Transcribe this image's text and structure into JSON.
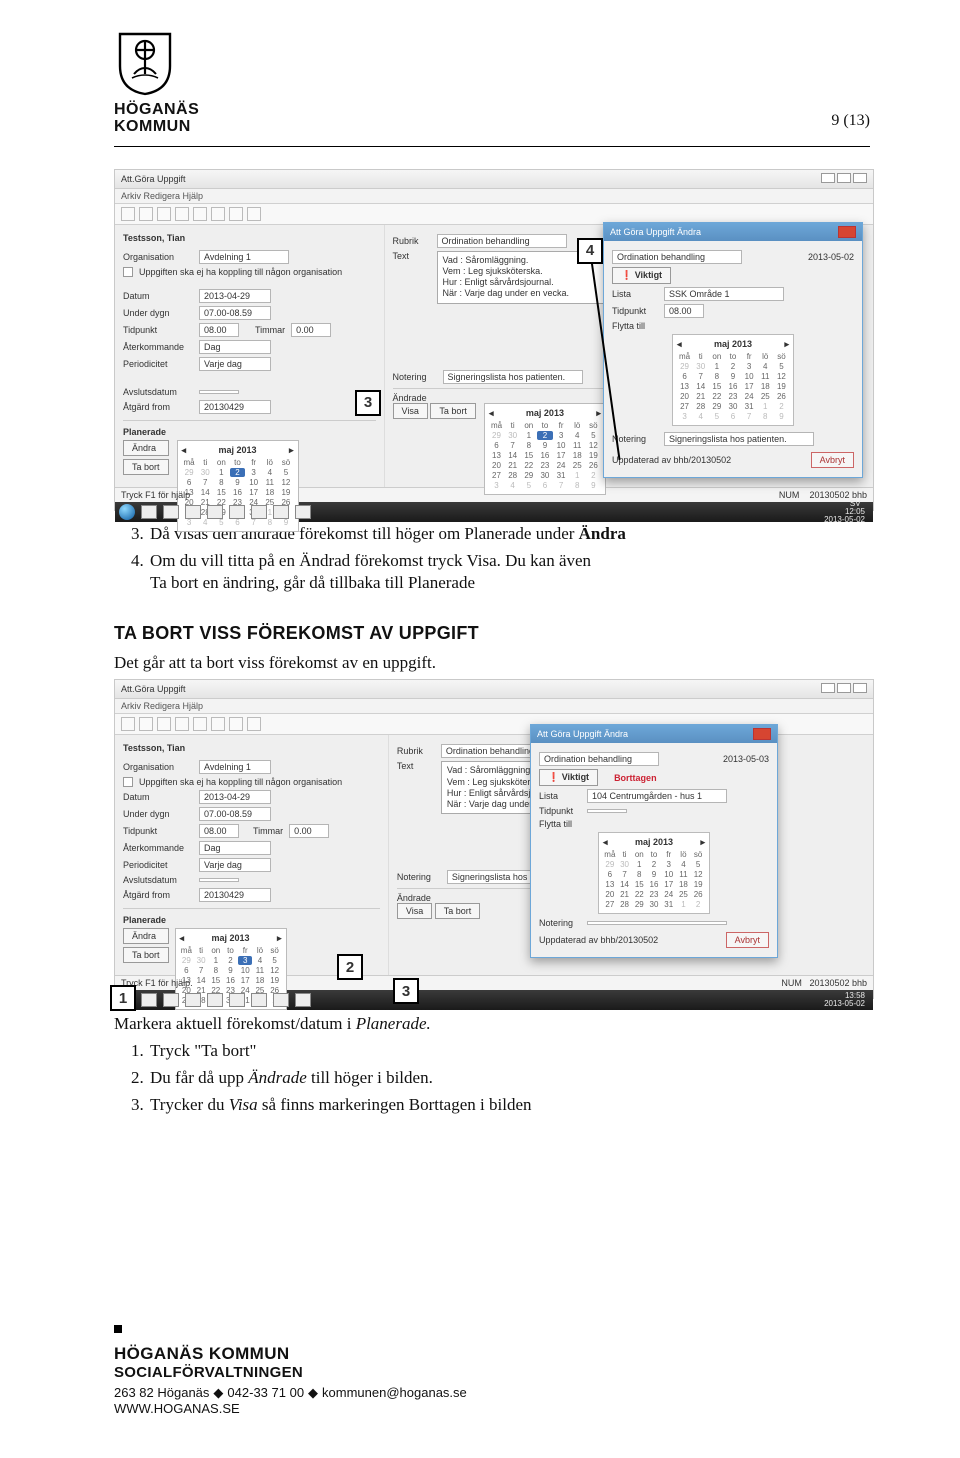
{
  "header": {
    "city_line1": "HÖGANÄS",
    "city_line2": "KOMMUN",
    "page_indicator": "9 (13)"
  },
  "screenshot1": {
    "window_title": "Att.Göra Uppgift",
    "menu": "Arkiv   Redigera   Hjälp",
    "person": "Testsson, Tian",
    "org_label": "Organisation",
    "org_value": "Avdelning 1",
    "checkbox": "Uppgiften ska ej ha koppling till någon organisation",
    "rubrik_label": "Rubrik",
    "rubrik_value": "Ordination behandling",
    "text_label": "Text",
    "textbox": "Vad : Såromläggning.\nVem : Leg sjuksköterska.\nHur : Enligt sårvårdsjournal.\nNär : Varje dag under en vecka.",
    "fields": {
      "datum": "Datum",
      "datum_v": "2013-04-29",
      "under_dygn": "Under dygn",
      "under_dygn_v": "07.00-08.59",
      "tidpunkt": "Tidpunkt",
      "tidpunkt_v": "08.00",
      "timmar": "Timmar",
      "timmar_v": "0.00",
      "aterkommande": "Återkommande",
      "aterkommande_v": "Dag",
      "periodicitet": "Periodicitet",
      "periodicitet_v": "Varje dag",
      "avslutsdatum": "Avslutsdatum",
      "atgard_from": "Åtgärd from",
      "atgard_from_v": "20130429",
      "notering": "Notering",
      "notering_v": "Signeringslista hos patienten."
    },
    "planerade": {
      "head": "Planerade",
      "andra_btn": "Ändra",
      "tabort_btn": "Ta bort",
      "cal_month": "maj 2013",
      "dow": [
        "må",
        "ti",
        "on",
        "to",
        "fr",
        "lö",
        "sö"
      ]
    },
    "andrade": {
      "head": "Ändrade",
      "visa_btn": "Visa",
      "tabort_btn": "Ta bort",
      "cal_month": "maj 2013"
    },
    "dialog": {
      "title": "Att Göra Uppgift Ändra",
      "ord": "Ordination behandling",
      "date": "2013-05-02",
      "viktigt": "Viktigt",
      "lista": "Lista",
      "lista_v": "SSK Område 1",
      "tidpunkt": "Tidpunkt",
      "tidpunkt_v": "08.00",
      "flytta": "Flytta till",
      "cal_month": "maj 2013",
      "notering": "Notering",
      "notering_v": "Signeringslista hos patienten.",
      "uppdaterad": "Uppdaterad av bhb/20130502",
      "avbryt": "Avbryt"
    },
    "status": {
      "hint": "Tryck F1 för hjälp",
      "num": "NUM",
      "stamp": "20130502  bhb"
    },
    "clock": {
      "t": "12:05",
      "d": "2013-05-02",
      "lang": "SV"
    },
    "callout3": "3",
    "callout4": "4"
  },
  "text_block1": {
    "step3": "Då visas den ändrade förekomst till höger om Planerade under ",
    "step3_bold": "Ändra",
    "step4a": "Om du vill titta på en Ändrad förekomst tryck Visa. Du kan även",
    "step4b": "Ta bort en ändring, går då tillbaka till Planerade"
  },
  "section2": {
    "heading": "TA BORT VISS FÖREKOMST AV UPPGIFT",
    "intro": "Det går att ta bort viss förekomst av en uppgift."
  },
  "screenshot2": {
    "window_title": "Att.Göra Uppgift",
    "menu": "Arkiv   Redigera   Hjälp",
    "person": "Testsson, Tian",
    "org_value": "Avdelning 1",
    "rubrik_value": "Ordination behandling",
    "textbox": "Vad : Såromläggning.\nVem : Leg sjuksköterska.\nHur : Enligt sårvårdsjournal.\nNär : Varje dag under en vecka.",
    "dialog": {
      "title": "Att Göra Uppgift Ändra",
      "ord": "Ordination behandling",
      "date": "2013-05-03",
      "viktigt": "Viktigt",
      "borttagen": "Borttagen",
      "lista": "Lista",
      "lista_v": "104 Centrumgården - hus 1",
      "tidpunkt": "Tidpunkt",
      "flytta": "Flytta till",
      "cal_month": "maj 2013",
      "notering": "Notering",
      "uppdaterad": "Uppdaterad av bhb/20130502",
      "avbryt": "Avbryt"
    },
    "planerade_head": "Planerade",
    "andrade_head": "Ändrade",
    "cal_month": "maj 2013",
    "andra_btn": "Ändra",
    "tabort_btn": "Ta bort",
    "visa_btn": "Visa",
    "status": {
      "hint": "Tryck F1 för hjälp.",
      "num": "NUM",
      "stamp": "20130502  bhb"
    },
    "clock": {
      "t": "13:58",
      "d": "2013-05-02"
    },
    "callout1": "1",
    "callout2": "2",
    "callout3": "3"
  },
  "text_block2": {
    "line0": "Markera aktuell förekomst/datum i ",
    "line0_italic": "Planerade.",
    "li1": "Tryck \"Ta bort\"",
    "li2a": "Du får då upp ",
    "li2_italic": "Ändrade",
    "li2b": " till höger i bilden.",
    "li3a": "Trycker du ",
    "li3_italic": "Visa",
    "li3b": " så finns markeringen Borttagen i bilden"
  },
  "footer": {
    "l1": "HÖGANÄS KOMMUN",
    "l2": "SOCIALFÖRVALTNINGEN",
    "addr": "263 82 Höganäs",
    "phone": "042-33 71 00",
    "email": "kommunen@hoganas.se",
    "web": "WWW.HOGANAS.SE"
  }
}
